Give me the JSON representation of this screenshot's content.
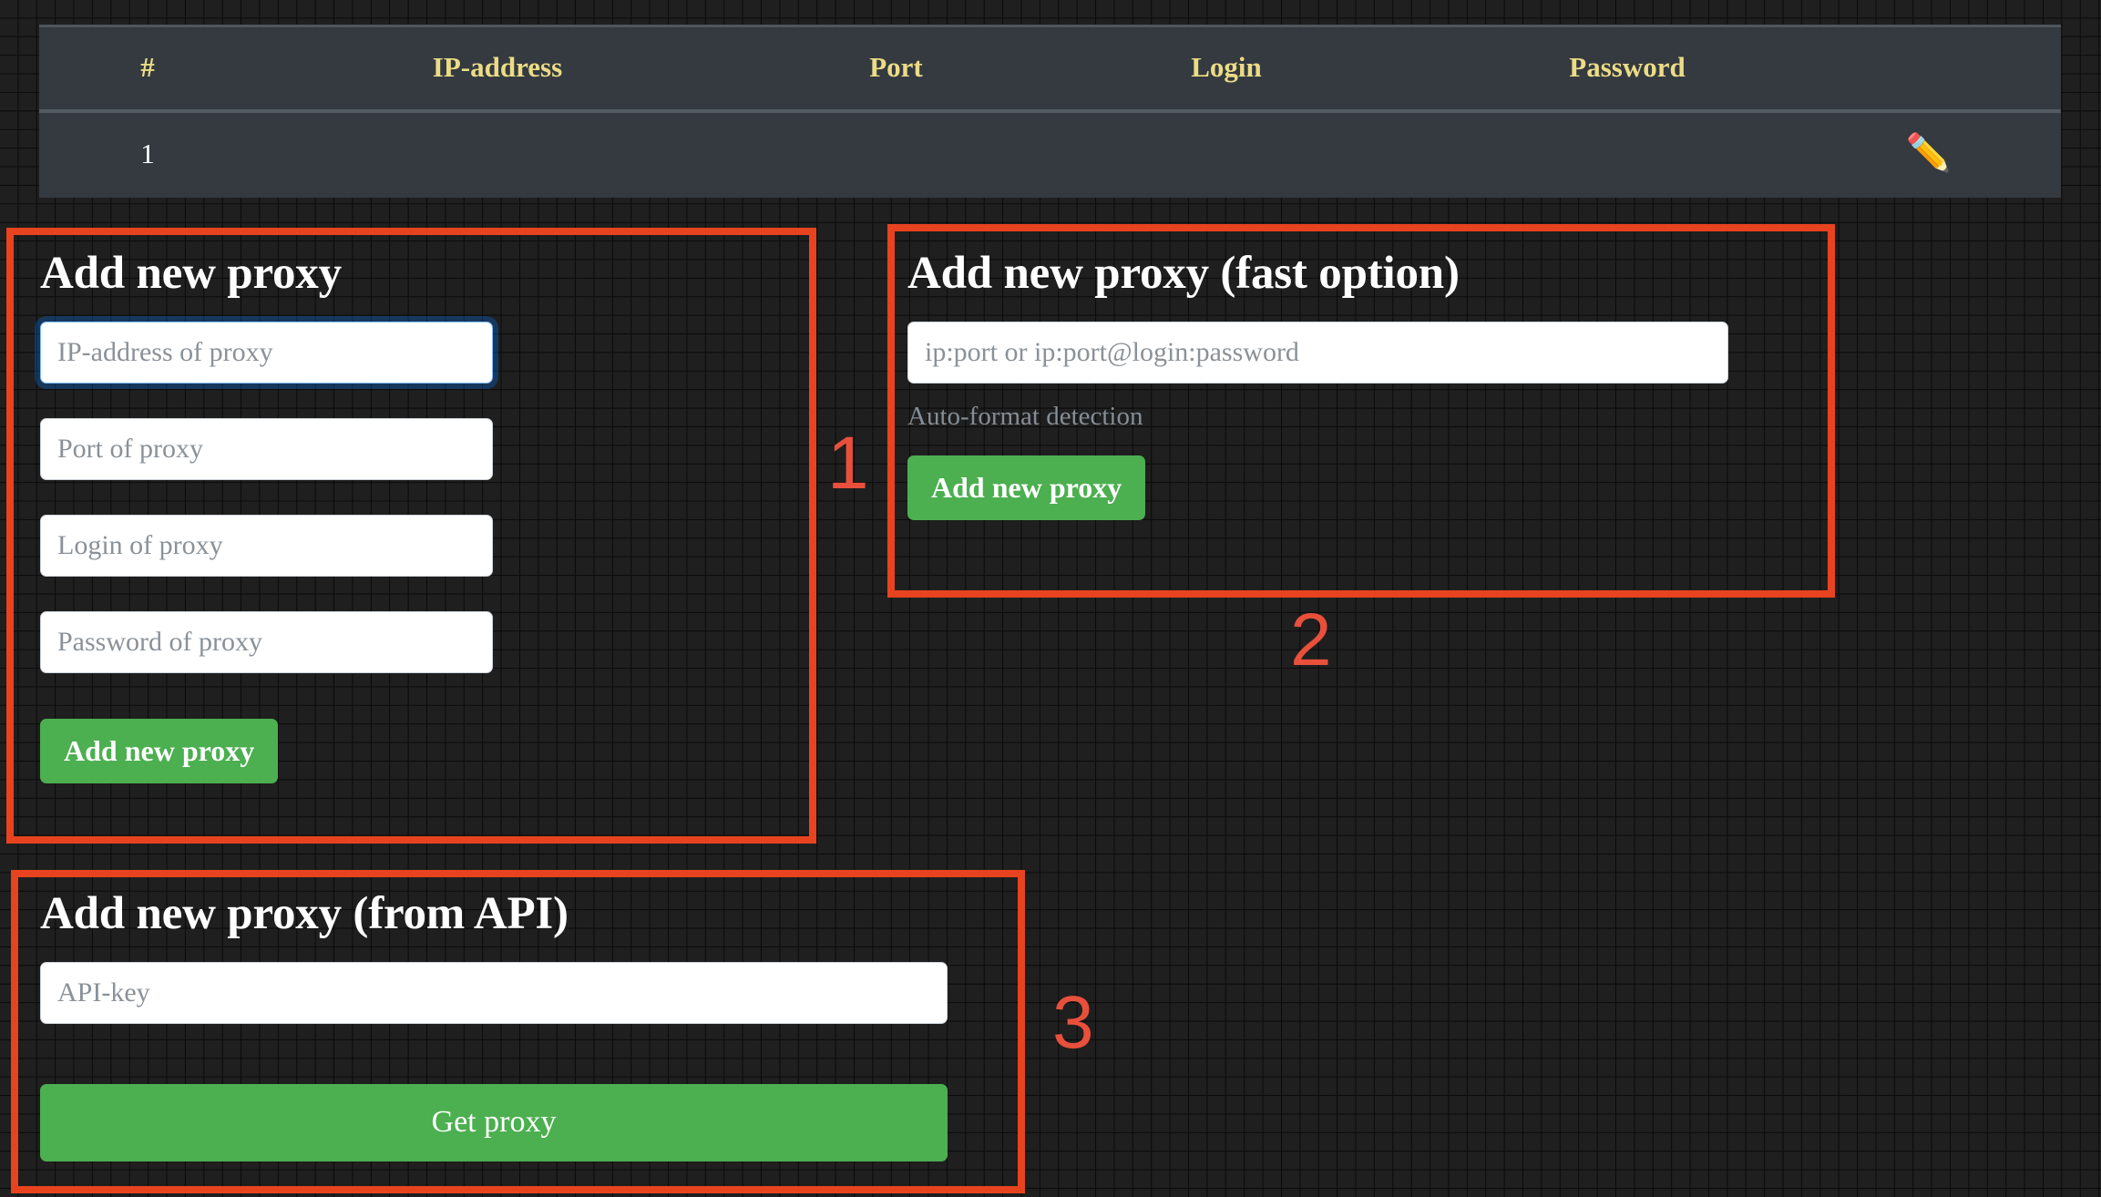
{
  "table": {
    "columns": [
      "#",
      "IP-address",
      "Port",
      "Login",
      "Password",
      ""
    ],
    "rows": [
      {
        "num": "1",
        "ip": "",
        "port": "",
        "login": "",
        "password": "",
        "action_icon": "✏️"
      }
    ]
  },
  "annotations": [
    {
      "id": "1",
      "label": "1"
    },
    {
      "id": "2",
      "label": "2"
    },
    {
      "id": "3",
      "label": "3"
    }
  ],
  "panel_manual": {
    "title": "Add new proxy",
    "ip_placeholder": "IP-address of proxy",
    "ip_value": "",
    "port_placeholder": "Port of proxy",
    "port_value": "",
    "login_placeholder": "Login of proxy",
    "login_value": "",
    "password_placeholder": "Password of proxy",
    "password_value": "",
    "submit_label": "Add new proxy"
  },
  "panel_fast": {
    "title": "Add new proxy (fast option)",
    "input_placeholder": "ip:port or ip:port@login:password",
    "input_value": "",
    "help_text": "Auto-format detection",
    "submit_label": "Add new proxy"
  },
  "panel_api": {
    "title": "Add new proxy (from API)",
    "apikey_placeholder": "API-key",
    "apikey_value": "",
    "submit_label": "Get proxy"
  },
  "colors": {
    "accent_green": "#4caf50",
    "annotation_red": "#e8431f",
    "annotation_number_red": "#e8503c",
    "table_header_text": "#ecdc86",
    "table_background": "#343a40",
    "page_background": "#1f1f1f",
    "focus_blue": "#80bdff"
  }
}
